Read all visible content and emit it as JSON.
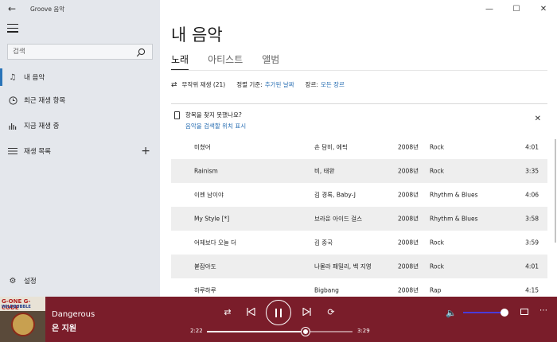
{
  "app": {
    "title": "Groove 음악"
  },
  "sidebar": {
    "search_placeholder": "검색",
    "items": [
      {
        "label": "내 음악",
        "icon": "music-note-icon"
      },
      {
        "label": "최근 재생 항목",
        "icon": "clock-icon"
      },
      {
        "label": "지금 재생 중",
        "icon": "bars-icon"
      },
      {
        "label": "재생 목록",
        "icon": "playlist-icon"
      }
    ],
    "settings_label": "설정"
  },
  "main": {
    "title": "내 음악",
    "tabs": [
      "노래",
      "아티스트",
      "앨범"
    ],
    "active_tab": "노래",
    "filters": {
      "shuffle_label": "무작위 재생 (21)",
      "sort_label": "정렬 기준:",
      "sort_value": "추가된 날짜",
      "genre_label": "장르:",
      "genre_value": "모든 장르"
    },
    "notice": {
      "title": "항목을 찾지 못했나요?",
      "link": "음악을 검색할 위치 표시"
    },
    "songs": [
      {
        "title": "미쳤어",
        "artist": "손 담비, 에픽",
        "year": "2008년",
        "genre": "Rock",
        "duration": "4:01"
      },
      {
        "title": "Rainism",
        "artist": "비, 태완",
        "year": "2008년",
        "genre": "Rock",
        "duration": "3:35"
      },
      {
        "title": "이젠 남이야",
        "artist": "김 경록, Baby-J",
        "year": "2008년",
        "genre": "Rhythm & Blues",
        "duration": "4:06"
      },
      {
        "title": "My Style [*]",
        "artist": "브라운 아이드 걸스",
        "year": "2008년",
        "genre": "Rhythm & Blues",
        "duration": "3:58"
      },
      {
        "title": "어제보다 오늘 더",
        "artist": "김 종국",
        "year": "2008년",
        "genre": "Rock",
        "duration": "3:59"
      },
      {
        "title": "붙잡아도",
        "artist": "나몰라 패밀리, 벡 지영",
        "year": "2008년",
        "genre": "Rock",
        "duration": "4:01"
      },
      {
        "title": "하루하루",
        "artist": "Bigbang",
        "year": "2008년",
        "genre": "Rap",
        "duration": "4:15"
      }
    ]
  },
  "player": {
    "song_title": "Dangerous",
    "artist": "은 지원",
    "current_time": "2:22",
    "total_time": "3:29",
    "progress_fraction": 0.68,
    "volume_fraction": 1.0,
    "album_text_1": "G-ONE G-CODE",
    "album_text_2": "WILDBUBBLE",
    "accent_color": "#7a1d2a"
  }
}
